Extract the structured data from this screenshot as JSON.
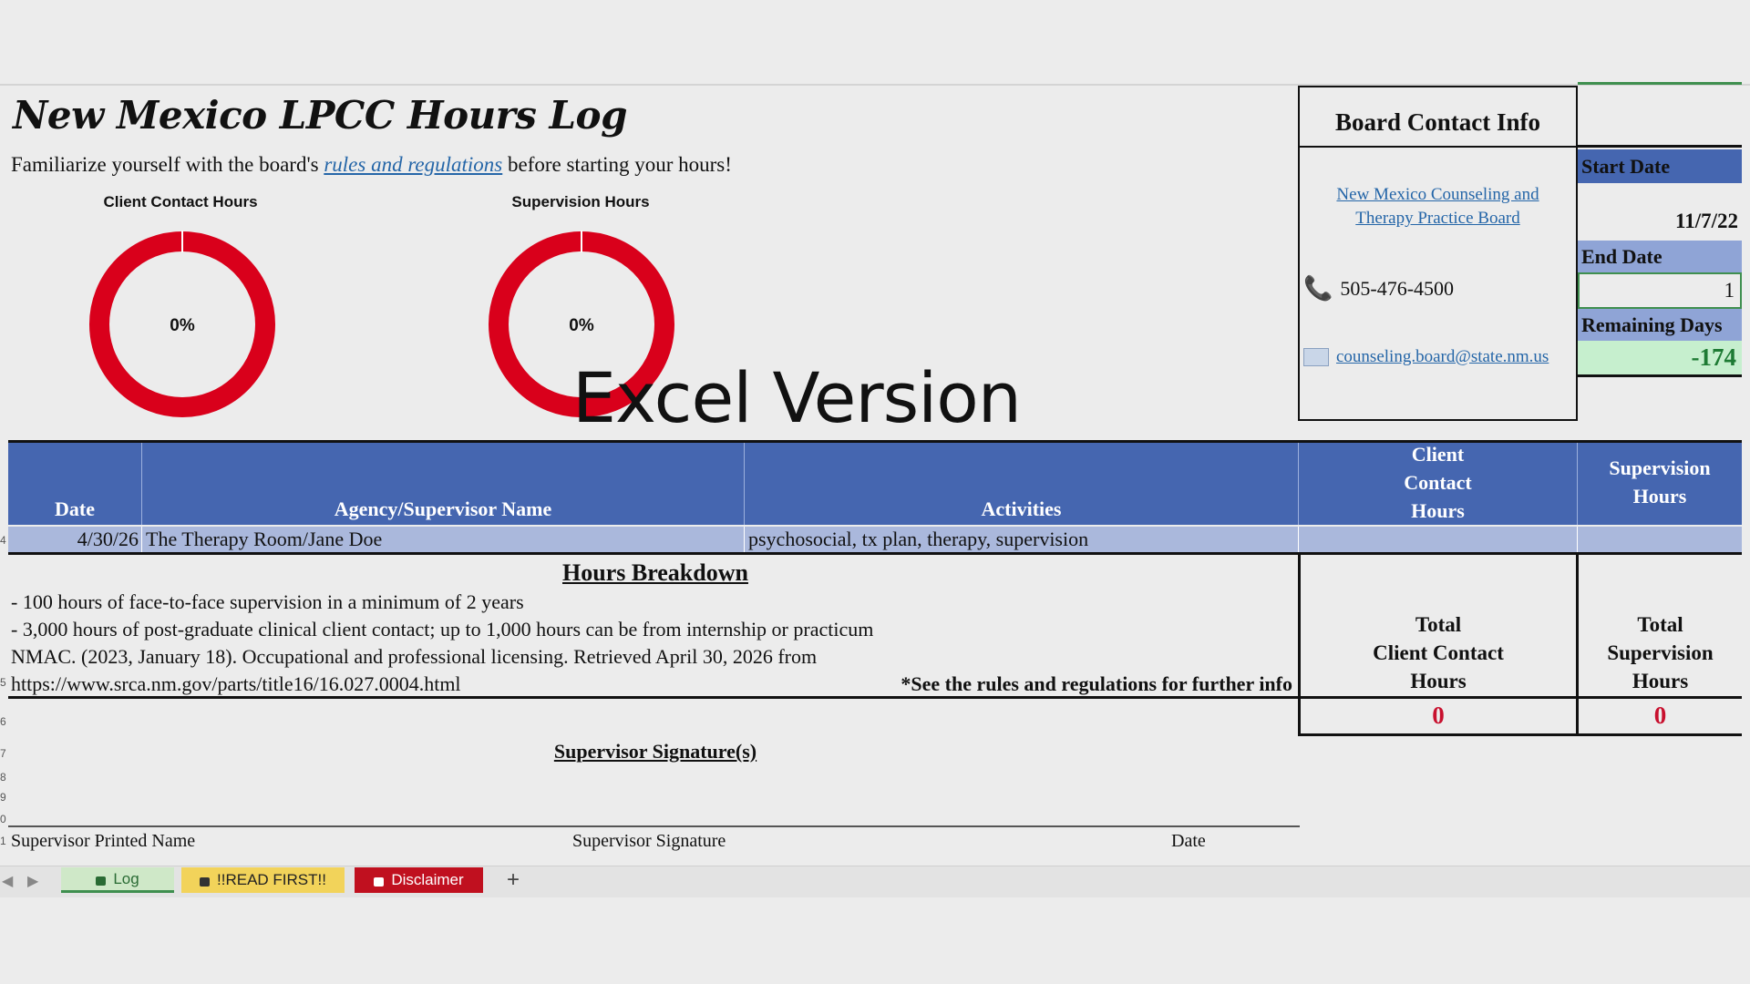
{
  "title": "New Mexico LPCC Hours Log",
  "subtitle": {
    "before": "Familiarize yourself with the board's ",
    "link": "rules and regulations",
    "after": " before starting your hours!"
  },
  "charts": {
    "client_label": "Client Contact Hours",
    "supervision_label": "Supervision Hours"
  },
  "chart_data": [
    {
      "type": "pie",
      "title": "Client Contact Hours",
      "center_label": "0%",
      "values": [
        0,
        100
      ],
      "colors": [
        "#4566b0",
        "#d9001b"
      ]
    },
    {
      "type": "pie",
      "title": "Supervision Hours",
      "center_label": "0%",
      "values": [
        0,
        100
      ],
      "colors": [
        "#4566b0",
        "#d9001b"
      ]
    }
  ],
  "watermark": "Excel Version",
  "board": {
    "heading": "Board Contact Info",
    "link_line1": "New Mexico Counseling and",
    "link_line2": "Therapy Practice Board",
    "phone": "505-476-4500",
    "email": "counseling.board@state.nm.us"
  },
  "dates": {
    "start_label": "Start Date",
    "start_value": "11/7/22",
    "end_label": "End Date",
    "end_value": "1",
    "remaining_label": "Remaining Days",
    "remaining_value": "-174"
  },
  "table": {
    "headers": {
      "date": "Date",
      "agency": "Agency/Supervisor Name",
      "activities": "Activities",
      "client_1": "Client",
      "client_2": "Contact",
      "client_3": "Hours",
      "sup_1": "Supervision",
      "sup_2": "Hours"
    },
    "row": {
      "date": "4/30/26",
      "agency": "The Therapy Room/Jane Doe",
      "activities": "psychosocial, tx plan, therapy, supervision"
    }
  },
  "breakdown": {
    "heading": "Hours Breakdown",
    "line1": "- 100 hours of face-to-face supervision in a minimum of 2 years",
    "line2": "- 3,000 hours of post-graduate clinical client contact; up to 1,000 hours can be from internship or practicum",
    "line3": "NMAC. (2023, January 18). Occupational and professional licensing. Retrieved April 30, 2026 from",
    "line4": "https://www.srca.nm.gov/parts/title16/16.027.0004.html",
    "note": "*See the rules and regulations for further info"
  },
  "totals": {
    "client_1": "Total",
    "client_2": "Client Contact",
    "client_3": "Hours",
    "client_value": "0",
    "sup_1": "Total",
    "sup_2": "Supervision",
    "sup_3": "Hours",
    "sup_value": "0"
  },
  "signature": {
    "heading": "Supervisor Signature(s)",
    "printed_name": "Supervisor Printed Name",
    "signature": "Supervisor Signature",
    "date": "Date"
  },
  "tabs": {
    "log": "Log",
    "read_first": "!!READ FIRST!!",
    "disclaimer": "Disclaimer",
    "add": "+"
  },
  "row_numbers": [
    "4",
    "5",
    "6",
    "7",
    "8",
    "9",
    "0",
    "1"
  ],
  "colors": {
    "header_blue": "#4566b0",
    "row_blue": "#aab8dc",
    "donut_red": "#d9001b",
    "remaining_green_bg": "#c6efce",
    "remaining_green_text": "#1e7b34",
    "zero_red": "#c8102e",
    "tab_log": "#cfe8c8",
    "tab_read": "#f2d35a",
    "tab_disclaimer": "#c0101f"
  }
}
